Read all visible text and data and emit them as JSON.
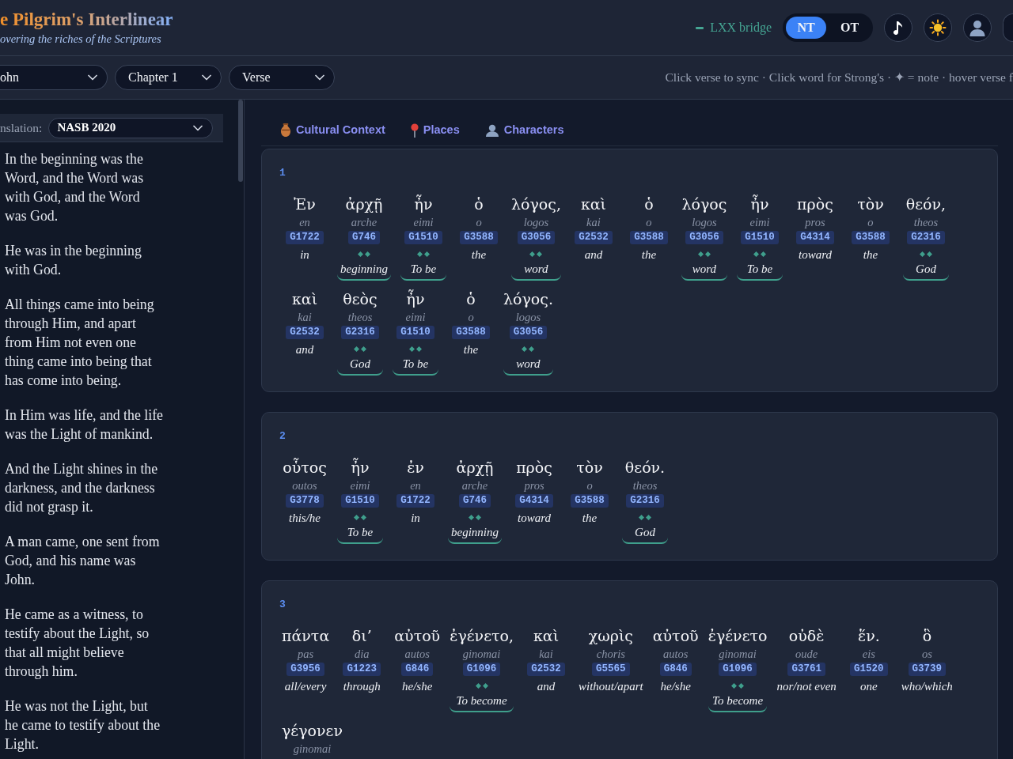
{
  "header": {
    "title": "e Pilgrim's Interlinear",
    "subtitle": "overing the riches of the Scriptures",
    "lxx_bridge": "LXX bridge",
    "testaments": [
      {
        "label": "NT",
        "selected": true
      },
      {
        "label": "OT",
        "selected": false
      }
    ]
  },
  "toolbar": {
    "selects": [
      "ohn",
      "Chapter 1",
      "Verse"
    ],
    "hint": "Click verse to sync · Click word for Strong's · ✦ = note · hover verse f"
  },
  "sidebar": {
    "translation_label": "nslation:",
    "translation": "NASB 2020",
    "verses": [
      "In the beginning was the Word, and the Word was with God, and the Word was God.",
      "He was in the beginning with God.",
      "All things came into being through Him, and apart from Him not even one thing came into being that has come into being.",
      "In Him was life, and the life was the Light of mankind.",
      "And the Light shines in the darkness, and the darkness did not grasp it.",
      "A man came, one sent from God, and his name was John.",
      "He came as a witness, to testify about the Light, so that all might believe through him.",
      "He was not the Light, but he came to testify about the Light."
    ]
  },
  "tabs": [
    {
      "kind": "culture",
      "label": "Cultural Context"
    },
    {
      "kind": "places",
      "label": "Places"
    },
    {
      "kind": "characters",
      "label": "Characters"
    }
  ],
  "verses": [
    {
      "number": "1",
      "words": [
        {
          "greek": "Ἐν",
          "translit": "en",
          "strongs": "G1722",
          "gloss": "in",
          "bridged": false
        },
        {
          "greek": "ἀρχῇ",
          "translit": "arche",
          "strongs": "G746",
          "gloss": "beginning",
          "bridged": true
        },
        {
          "greek": "ἦν",
          "translit": "eimi",
          "strongs": "G1510",
          "gloss": "To be",
          "bridged": true
        },
        {
          "greek": "ὁ",
          "translit": "o",
          "strongs": "G3588",
          "gloss": "the",
          "bridged": false
        },
        {
          "greek": "λόγος,",
          "translit": "logos",
          "strongs": "G3056",
          "gloss": "word",
          "bridged": true
        },
        {
          "greek": "καὶ",
          "translit": "kai",
          "strongs": "G2532",
          "gloss": "and",
          "bridged": false
        },
        {
          "greek": "ὁ",
          "translit": "o",
          "strongs": "G3588",
          "gloss": "the",
          "bridged": false
        },
        {
          "greek": "λόγος",
          "translit": "logos",
          "strongs": "G3056",
          "gloss": "word",
          "bridged": true
        },
        {
          "greek": "ἦν",
          "translit": "eimi",
          "strongs": "G1510",
          "gloss": "To be",
          "bridged": true
        },
        {
          "greek": "πρὸς",
          "translit": "pros",
          "strongs": "G4314",
          "gloss": "toward",
          "bridged": false
        },
        {
          "greek": "τὸν",
          "translit": "o",
          "strongs": "G3588",
          "gloss": "the",
          "bridged": false
        },
        {
          "greek": "θεόν,",
          "translit": "theos",
          "strongs": "G2316",
          "gloss": "God",
          "bridged": true
        },
        {
          "greek": "καὶ",
          "translit": "kai",
          "strongs": "G2532",
          "gloss": "and",
          "bridged": false
        },
        {
          "greek": "θεὸς",
          "translit": "theos",
          "strongs": "G2316",
          "gloss": "God",
          "bridged": true
        },
        {
          "greek": "ἦν",
          "translit": "eimi",
          "strongs": "G1510",
          "gloss": "To be",
          "bridged": true
        },
        {
          "greek": "ὁ",
          "translit": "o",
          "strongs": "G3588",
          "gloss": "the",
          "bridged": false
        },
        {
          "greek": "λόγος.",
          "translit": "logos",
          "strongs": "G3056",
          "gloss": "word",
          "bridged": true
        }
      ]
    },
    {
      "number": "2",
      "words": [
        {
          "greek": "οὗτος",
          "translit": "outos",
          "strongs": "G3778",
          "gloss": "this/he",
          "bridged": false
        },
        {
          "greek": "ἦν",
          "translit": "eimi",
          "strongs": "G1510",
          "gloss": "To be",
          "bridged": true
        },
        {
          "greek": "ἐν",
          "translit": "en",
          "strongs": "G1722",
          "gloss": "in",
          "bridged": false
        },
        {
          "greek": "ἀρχῇ",
          "translit": "arche",
          "strongs": "G746",
          "gloss": "beginning",
          "bridged": true
        },
        {
          "greek": "πρὸς",
          "translit": "pros",
          "strongs": "G4314",
          "gloss": "toward",
          "bridged": false
        },
        {
          "greek": "τὸν",
          "translit": "o",
          "strongs": "G3588",
          "gloss": "the",
          "bridged": false
        },
        {
          "greek": "θεόν.",
          "translit": "theos",
          "strongs": "G2316",
          "gloss": "God",
          "bridged": true
        }
      ]
    },
    {
      "number": "3",
      "words": [
        {
          "greek": "πάντα",
          "translit": "pas",
          "strongs": "G3956",
          "gloss": "all/every",
          "bridged": false
        },
        {
          "greek": "δι’",
          "translit": "dia",
          "strongs": "G1223",
          "gloss": "through",
          "bridged": false
        },
        {
          "greek": "αὐτοῦ",
          "translit": "autos",
          "strongs": "G846",
          "gloss": "he/she",
          "bridged": false
        },
        {
          "greek": "ἐγένετο,",
          "translit": "ginomai",
          "strongs": "G1096",
          "gloss": "To become",
          "bridged": true
        },
        {
          "greek": "καὶ",
          "translit": "kai",
          "strongs": "G2532",
          "gloss": "and",
          "bridged": false
        },
        {
          "greek": "χωρὶς",
          "translit": "choris",
          "strongs": "G5565",
          "gloss": "without/apart",
          "bridged": false
        },
        {
          "greek": "αὐτοῦ",
          "translit": "autos",
          "strongs": "G846",
          "gloss": "he/she",
          "bridged": false
        },
        {
          "greek": "ἐγένετο",
          "translit": "ginomai",
          "strongs": "G1096",
          "gloss": "To become",
          "bridged": true
        },
        {
          "greek": "οὐδὲ",
          "translit": "oude",
          "strongs": "G3761",
          "gloss": "nor/not even",
          "bridged": false
        },
        {
          "greek": "ἕν.",
          "translit": "eis",
          "strongs": "G1520",
          "gloss": "one",
          "bridged": false
        },
        {
          "greek": "ὃ",
          "translit": "os",
          "strongs": "G3739",
          "gloss": "who/which",
          "bridged": false
        },
        {
          "greek": "γέγονεν",
          "translit": "ginomai"
        }
      ]
    }
  ]
}
